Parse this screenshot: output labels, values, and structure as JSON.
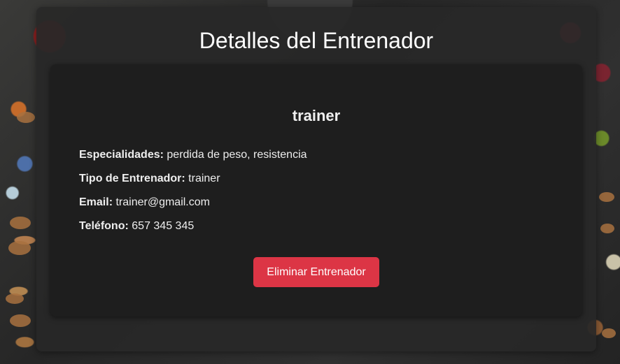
{
  "page": {
    "title": "Detalles del Entrenador"
  },
  "trainer": {
    "name": "trainer",
    "fields": [
      {
        "label": "Especialidades:",
        "value": "perdida de peso, resistencia"
      },
      {
        "label": "Tipo de Entrenador:",
        "value": "trainer"
      },
      {
        "label": "Email:",
        "value": "trainer@gmail.com"
      },
      {
        "label": "Teléfono:",
        "value": "657 345 345"
      }
    ]
  },
  "actions": {
    "delete_label": "Eliminar Entrenador"
  },
  "colors": {
    "danger": "#dc3545",
    "card": "#1e1e1e",
    "panel": "#282828"
  }
}
